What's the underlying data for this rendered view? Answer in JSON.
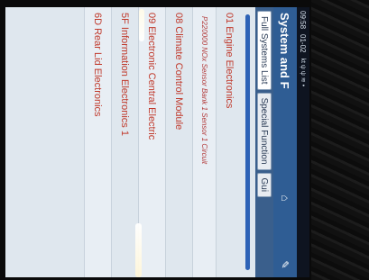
{
  "status_bar": {
    "time": "09:58",
    "date": "01-02",
    "indicators": "kt ψ ψ ≋ •"
  },
  "app": {
    "title": "System and F"
  },
  "tabs": [
    {
      "label": "Full Systems List"
    },
    {
      "label": "Special Function"
    },
    {
      "label": "Gui"
    }
  ],
  "progress": {
    "fraction": 1.0
  },
  "list": [
    {
      "label": "01 Engine Electronics"
    },
    {
      "label": "P220000 NOx Sensor Bank 1 Sensor 1 Circuit"
    },
    {
      "label": "08 Climate Control Module"
    },
    {
      "label": "09 Electronic Central Electric"
    },
    {
      "label": "5F Information Electronics 1"
    },
    {
      "label": "6D Rear Lid Electronics"
    }
  ]
}
